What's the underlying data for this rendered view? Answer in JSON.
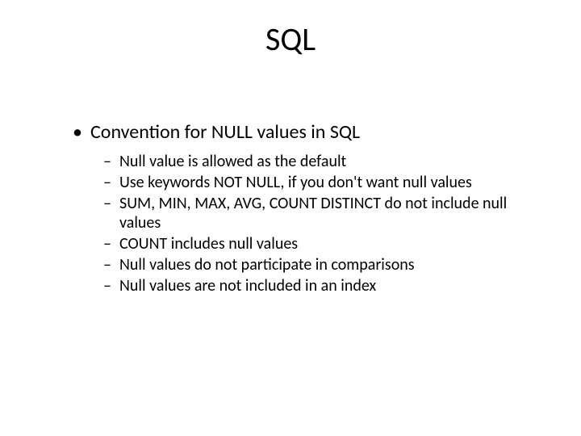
{
  "title": "SQL",
  "l1_text": "Convention for NULL values in SQL",
  "bullets": {
    "b0": "Null value is allowed as the default",
    "b1": "Use keywords NOT NULL, if you don't want null values",
    "b2": "SUM, MIN, MAX, AVG, COUNT DISTINCT do not include null values",
    "b3": "COUNT includes null values",
    "b4": "Null values do not participate in comparisons",
    "b5": "Null values are not included in an index"
  },
  "glyphs": {
    "dot": "•",
    "dash": "–"
  }
}
